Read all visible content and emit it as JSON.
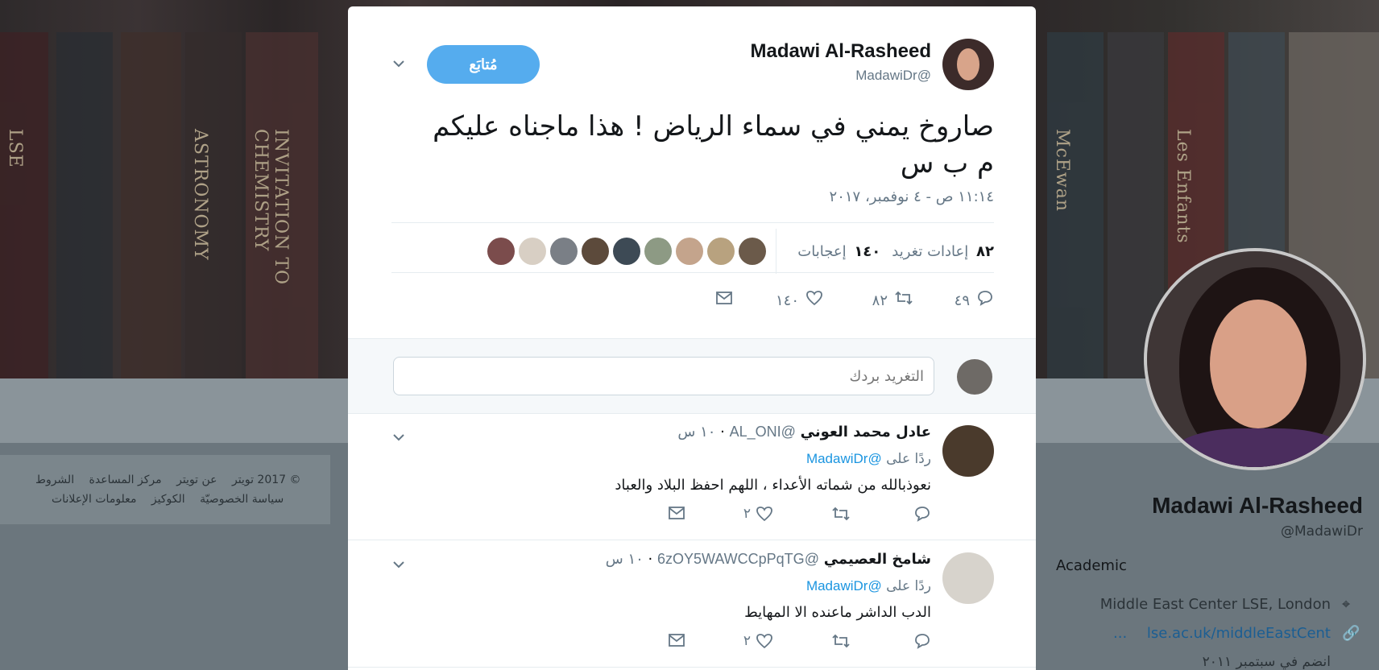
{
  "background_profile": {
    "books": [
      "INVITATION TO CHEMISTRY",
      "ASTRONOMY",
      "McEwan",
      "Les Enfants",
      "LSE"
    ],
    "footer": {
      "row1": [
        "© 2017 تويتر",
        "عن تويتر",
        "مركز المساعدة",
        "الشروط"
      ],
      "row2": [
        "سياسة الخصوصيّة",
        "الكوكيز",
        "معلومات الإعلانات"
      ]
    },
    "name": "Madawi Al-Rasheed",
    "handle": "@MadawiDr",
    "bio": "Academic",
    "location": "Middle East Center LSE, London",
    "link": "lse.ac.uk/middleEastCent",
    "link_more": "...",
    "joined": "انضم في سبتمبر ٢٠١١"
  },
  "tweet": {
    "author_name": "Madawi Al-Rasheed",
    "author_handle": "@MadawiDr",
    "follow_label": "مُتابَع",
    "text": "صاروخ يمني في سماء الرياض ! هذا ماجناه عليكم م ب س",
    "timestamp": "١١:١٤ ص - ٤ نوفمبر، ٢٠١٧",
    "retweets_count": "٨٢",
    "retweets_label": "إعادات تغريد",
    "likes_count": "١٤٠",
    "likes_label": "إعجابات",
    "actions": {
      "replies": "٤٩",
      "retweets": "٨٢",
      "likes": "١٤٠"
    },
    "liker_colors": [
      "#6b5a4a",
      "#b8a27f",
      "#c4a48c",
      "#8d9a84",
      "#3d4a55",
      "#5c4a3b",
      "#7a7f86",
      "#d8cfc4",
      "#7b4c4c"
    ]
  },
  "reply_box": {
    "placeholder": "التغريد بردك"
  },
  "replies": [
    {
      "name": "عادل محمد العوني",
      "handle": "@AL_ONI",
      "time": "١٠ س",
      "replying_prefix": "ردًا على",
      "replying_to": "@MadawiDr",
      "text": "نعوذبالله من شماته الأعداء ، اللهم احفظ البلاد والعباد",
      "likes": "٢"
    },
    {
      "name": "شامخ العصيمي",
      "handle": "@6zOY5WAWCCpPqTG",
      "time": "١٠ س",
      "replying_prefix": "ردًا على",
      "replying_to": "@MadawiDr",
      "text": "الدب الداشر ماعنده الا المهايط",
      "likes": "٢"
    }
  ],
  "colors": {
    "accent": "#55acee",
    "link": "#1b95e0",
    "muted": "#657786",
    "text": "#14171a"
  },
  "icons": [
    "chevron-down-icon",
    "reply-icon",
    "retweet-icon",
    "like-icon",
    "message-icon",
    "location-icon",
    "link-icon"
  ]
}
